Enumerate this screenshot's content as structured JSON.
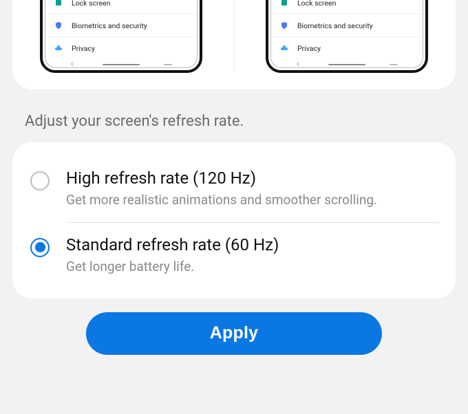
{
  "preview": {
    "items": [
      {
        "icon": "lock-icon",
        "label": "Lock screen"
      },
      {
        "icon": "shield-icon",
        "label": "Biometrics and security"
      },
      {
        "icon": "cloud-icon",
        "label": "Privacy"
      }
    ]
  },
  "subtitle": "Adjust your screen's refresh rate.",
  "options": [
    {
      "title": "High refresh rate (120 Hz)",
      "desc": "Get more realistic animations and smoother scrolling.",
      "selected": false
    },
    {
      "title": "Standard refresh rate (60 Hz)",
      "desc": "Get longer battery life.",
      "selected": true
    }
  ],
  "apply_label": "Apply"
}
